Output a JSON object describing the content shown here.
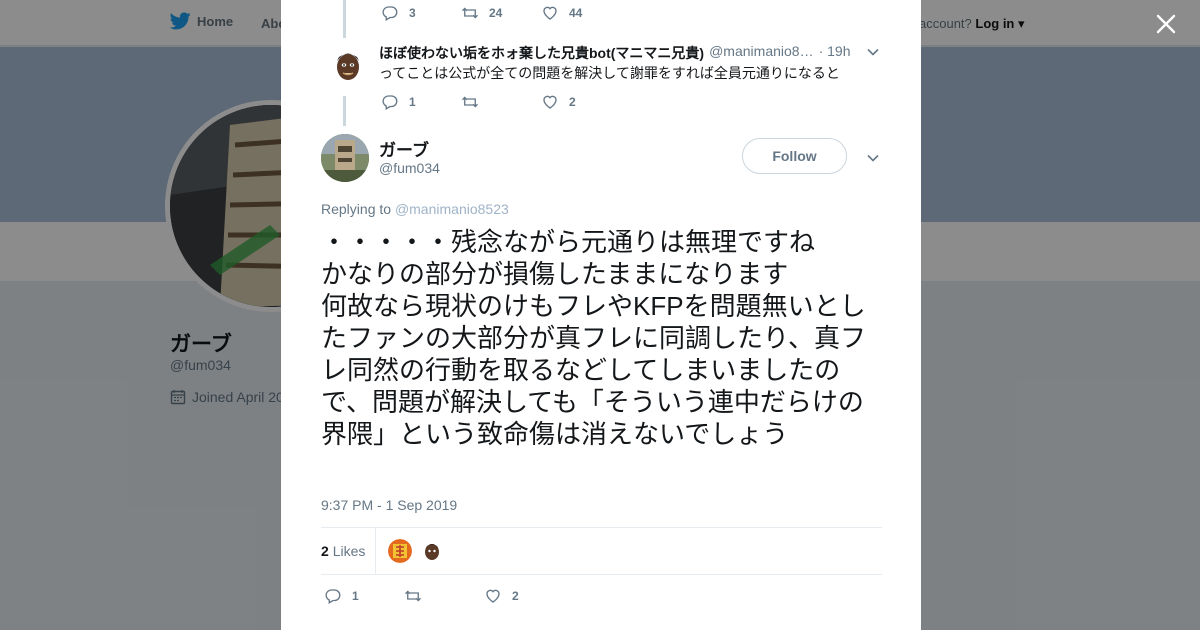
{
  "nav": {
    "home": "Home",
    "about": "Abo",
    "account_prompt": "account?",
    "login": "Log in"
  },
  "profile": {
    "name": "ガーブ",
    "handle": "@fum034",
    "joined": "Joined April 20"
  },
  "prev_tweet_actions": {
    "replies": "3",
    "retweets": "24",
    "likes": "44"
  },
  "reply_tweet": {
    "name": "ほぼ使わない垢をホォ棄した兄貴bot(マニマニ兄貴)",
    "handle": "@manimanio8…",
    "time": "· 19h",
    "text": "ってことは公式が全ての問題を解決して謝罪をすれば全員元通りになると",
    "replies": "1",
    "retweets": "",
    "likes": "2"
  },
  "main_tweet": {
    "name": "ガーブ",
    "handle": "@fum034",
    "follow_label": "Follow",
    "replying_label": "Replying to",
    "replying_to": "@manimanio8523",
    "text": "・・・・・残念ながら元通りは無理ですね\nかなりの部分が損傷したままになります\n何故なら現状のけもフレやKFPを問題無いとしたファンの大部分が真フレに同調したり、真フレ同然の行動を取るなどしてしまいましたので、問題が解決しても「そういう連中だらけの界隈」という致命傷は消えないでしょう",
    "timestamp": "9:37 PM - 1 Sep 2019",
    "likes_count": "2",
    "likes_label": "Likes",
    "replies": "1",
    "retweets": "",
    "likes": "2"
  },
  "colors": {
    "twitter_blue": "#1da1f2",
    "like_red": "#e0245e",
    "text_secondary": "#657786"
  },
  "icons": [
    "twitter-bird-icon",
    "close-icon",
    "reply-icon",
    "retweet-icon",
    "heart-icon",
    "chevron-down-icon",
    "calendar-icon"
  ]
}
